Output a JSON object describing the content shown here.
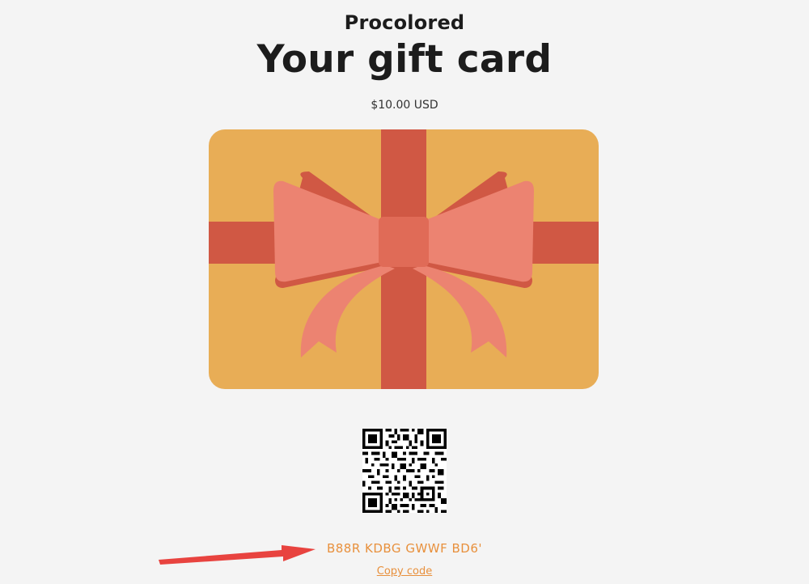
{
  "header": {
    "shop_name": "Procolored",
    "title": "Your gift card",
    "amount": "$10.00 USD"
  },
  "gift_card": {
    "code": "B88R KDBG GWWF BD6'",
    "copy_label": "Copy code"
  },
  "colors": {
    "page_background": "#f4f4f4",
    "card": "#e8ad56",
    "ribbon": "#d05844",
    "bow": "#ec8371",
    "bow_knot": "#e06b57",
    "code_accent": "#e8903c",
    "annotation_arrow": "#e8433f"
  },
  "icons": {
    "gift_card_art": "gift-card-ribbon-bow-illustration",
    "qr": "qr-code",
    "annotation": "red-arrow-pointing-to-code"
  }
}
